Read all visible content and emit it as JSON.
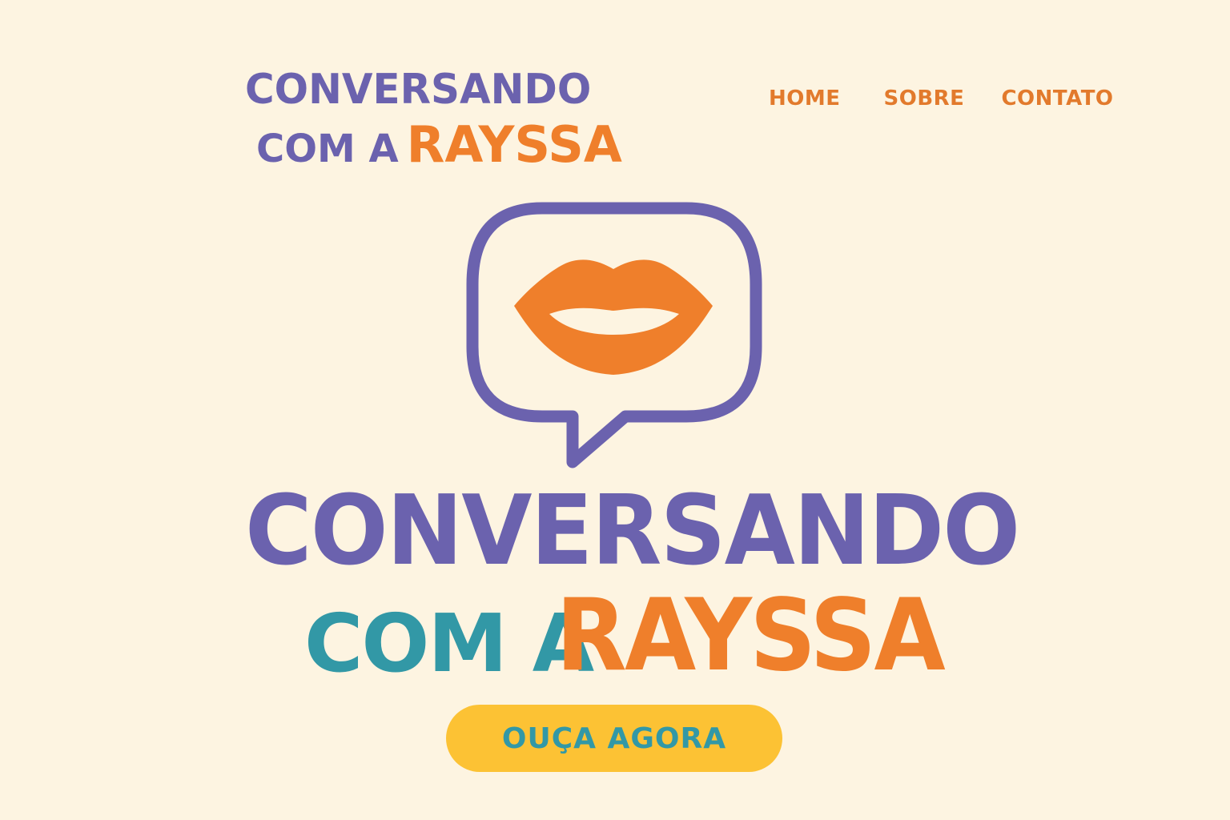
{
  "header": {
    "logo": {
      "line1": "CONVERSANDO",
      "com_a": "COM A",
      "name": "RAYSSA"
    },
    "nav": {
      "home": "HOME",
      "sobre": "SOBRE",
      "contato": "CONTATO"
    }
  },
  "hero": {
    "icon": "speech-bubble-lips-icon",
    "title_line1": "CONVERSANDO",
    "title_com_a": "COM A",
    "title_name": "RAYSSA",
    "cta_label": "OUÇA AGORA"
  },
  "colors": {
    "background": "#FDF4E1",
    "purple": "#6B62AE",
    "orange": "#EF7F2B",
    "teal": "#3298A6",
    "yellow": "#FCC234"
  }
}
